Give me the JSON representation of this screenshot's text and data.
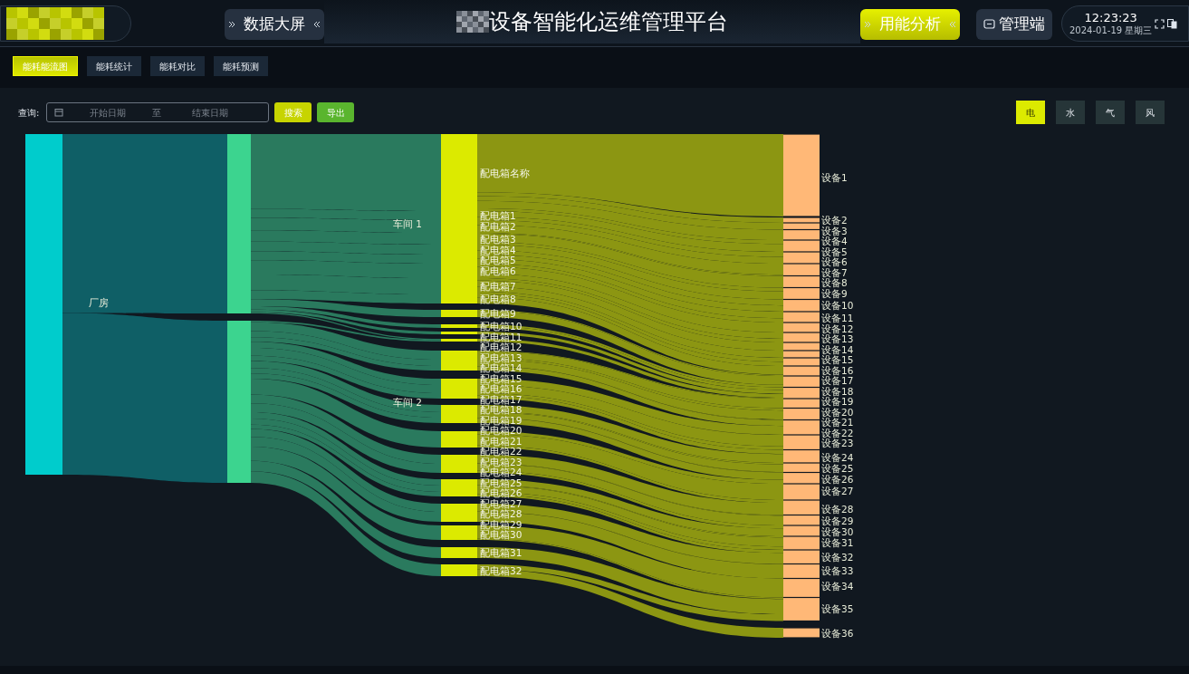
{
  "header": {
    "title": "设备智能化运维管理平台",
    "nav": [
      {
        "label": "数据大屏",
        "selected": false,
        "kind": "chevrons"
      },
      {
        "label": "用能分析",
        "selected": true,
        "kind": "chevrons"
      },
      {
        "label": "管理端",
        "selected": false,
        "kind": "icon"
      }
    ],
    "clock": {
      "time": "12:23:23",
      "date": "2024-01-19 星期三"
    }
  },
  "tabs": [
    {
      "label": "能耗能流图",
      "selected": true
    },
    {
      "label": "能耗统计",
      "selected": false
    },
    {
      "label": "能耗对比",
      "selected": false
    },
    {
      "label": "能耗预测",
      "selected": false
    }
  ],
  "query": {
    "label": "查询:",
    "start_placeholder": "开始日期",
    "separator": "至",
    "end_placeholder": "结束日期",
    "buttons": [
      {
        "label": "搜索",
        "kind": "search"
      },
      {
        "label": "导出",
        "kind": "export"
      }
    ]
  },
  "energy_types": [
    {
      "label": "电",
      "selected": true
    },
    {
      "label": "水",
      "selected": false
    },
    {
      "label": "气",
      "selected": false
    },
    {
      "label": "风",
      "selected": false
    }
  ],
  "sankey": {
    "plant": "厂房",
    "workshops": [
      "车间 1",
      "车间 2"
    ],
    "boxes": [
      "配电箱名称",
      "配电箱1",
      "配电箱2",
      "配电箱3",
      "配电箱4",
      "配电箱5",
      "配电箱6",
      "配电箱7",
      "配电箱8",
      "配电箱9",
      "配电箱10",
      "配电箱11",
      "配电箱12",
      "配电箱13",
      "配电箱14",
      "配电箱15",
      "配电箱16",
      "配电箱17",
      "配电箱18",
      "配电箱19",
      "配电箱20",
      "配电箱21",
      "配电箱22",
      "配电箱23",
      "配电箱24",
      "配电箱25",
      "配电箱26",
      "配电箱27",
      "配电箱28",
      "配电箱29",
      "配电箱30",
      "配电箱31",
      "配电箱32"
    ],
    "devices": [
      "设备1",
      "设备2",
      "设备3",
      "设备4",
      "设备5",
      "设备6",
      "设备7",
      "设备8",
      "设备9",
      "设备10",
      "设备11",
      "设备12",
      "设备13",
      "设备14",
      "设备15",
      "设备16",
      "设备17",
      "设备18",
      "设备19",
      "设备20",
      "设备21",
      "设备22",
      "设备23",
      "设备24",
      "设备25",
      "设备26",
      "设备27",
      "设备28",
      "设备29",
      "设备30",
      "设备31",
      "设备32",
      "设备33",
      "设备34",
      "设备35",
      "设备36"
    ]
  }
}
